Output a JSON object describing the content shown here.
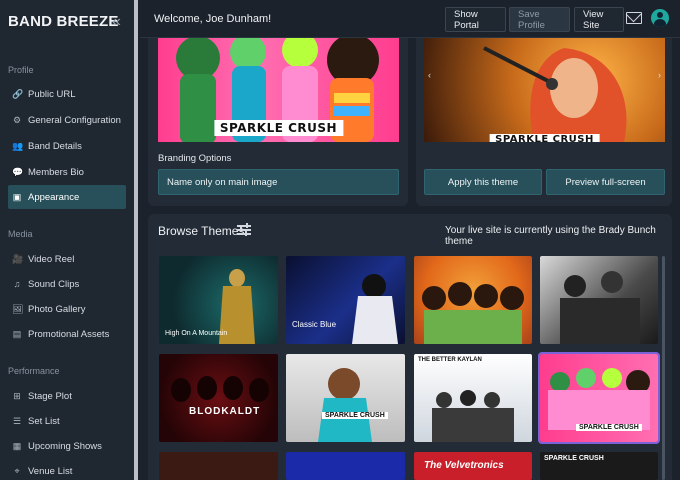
{
  "app": {
    "brand": "BAND BREEZE"
  },
  "sidebar": {
    "sections": [
      {
        "title": "Profile",
        "items": [
          {
            "label": "Public URL",
            "icon": "link-icon",
            "glyph": "🔗"
          },
          {
            "label": "General Configuration",
            "icon": "settings-icon",
            "glyph": "⚙"
          },
          {
            "label": "Band Details",
            "icon": "people-icon",
            "glyph": "👥"
          },
          {
            "label": "Members Bio",
            "icon": "chat-icon",
            "glyph": "💬"
          },
          {
            "label": "Appearance",
            "icon": "layout-icon",
            "glyph": "▣",
            "active": true
          }
        ]
      },
      {
        "title": "Media",
        "items": [
          {
            "label": "Video Reel",
            "icon": "video-icon",
            "glyph": "🎥"
          },
          {
            "label": "Sound Clips",
            "icon": "music-icon",
            "glyph": "♫"
          },
          {
            "label": "Photo Gallery",
            "icon": "image-icon",
            "glyph": "🖼"
          },
          {
            "label": "Promotional Assets",
            "icon": "document-icon",
            "glyph": "▤"
          }
        ]
      },
      {
        "title": "Performance",
        "items": [
          {
            "label": "Stage Plot",
            "icon": "grid-icon",
            "glyph": "⊞"
          },
          {
            "label": "Set List",
            "icon": "list-icon",
            "glyph": "☰"
          },
          {
            "label": "Upcoming Shows",
            "icon": "calendar-icon",
            "glyph": "▦"
          },
          {
            "label": "Venue List",
            "icon": "location-icon",
            "glyph": "⌖"
          }
        ]
      }
    ]
  },
  "header": {
    "welcome": "Welcome, Joe Dunham!",
    "buttons": [
      "Show Portal",
      "Save Profile",
      "View Site"
    ]
  },
  "current_theme": {
    "preview_caption": "SPARKLE CRUSH",
    "branding_label": "Branding Options",
    "branding_value": "Name only on main image",
    "secondary_caption": "SPARKLE CRUSH",
    "apply_button": "Apply this theme",
    "preview_button": "Preview full-screen"
  },
  "browse": {
    "title": "Browse Themes",
    "live_note": "Your live site is currently using the Brady Bunch theme",
    "themes": [
      {
        "name": "High On A Mountain"
      },
      {
        "name": "Classic Blue"
      },
      {
        "name": ""
      },
      {
        "name": ""
      },
      {
        "name": "BLODKALDT"
      },
      {
        "name": "SPARKLE CRUSH"
      },
      {
        "name": "THE BETTER KAYLAN"
      },
      {
        "name": "SPARKLE CRUSH",
        "selected": true
      },
      {
        "name": ""
      },
      {
        "name": ""
      },
      {
        "name": "The Velvetronics"
      },
      {
        "name": "SPARKLE CRUSH"
      }
    ]
  },
  "colors": {
    "accent": "#27505a",
    "selection": "#7b62d9",
    "background": "#1b222b"
  }
}
